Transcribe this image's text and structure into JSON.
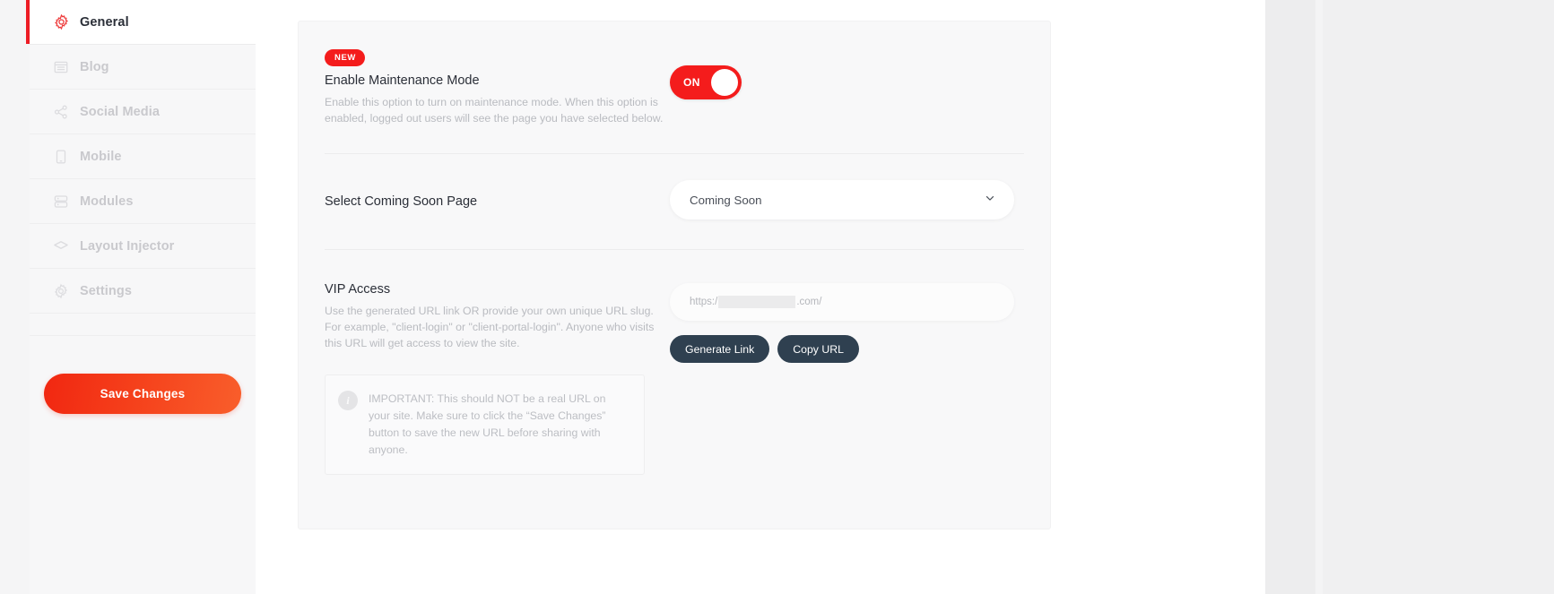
{
  "sidebar": {
    "items": [
      {
        "label": "General",
        "icon": "gear-icon",
        "active": true
      },
      {
        "label": "Blog",
        "icon": "blog-icon",
        "active": false
      },
      {
        "label": "Social Media",
        "icon": "share-icon",
        "active": false
      },
      {
        "label": "Mobile",
        "icon": "mobile-icon",
        "active": false
      },
      {
        "label": "Modules",
        "icon": "modules-icon",
        "active": false
      },
      {
        "label": "Layout Injector",
        "icon": "layers-icon",
        "active": false
      },
      {
        "label": "Settings",
        "icon": "settings-gear-icon",
        "active": false
      }
    ],
    "save_label": "Save Changes"
  },
  "maintenance": {
    "badge": "NEW",
    "title": "Enable Maintenance Mode",
    "description": "Enable this option to turn on maintenance mode. When this option is enabled, logged out users will see the page you have selected below.",
    "toggle_state": "ON"
  },
  "coming_soon": {
    "label": "Select Coming Soon Page",
    "selected": "Coming Soon",
    "chevron": "chevron-down-icon"
  },
  "vip": {
    "title": "VIP Access",
    "description": "Use the generated URL link OR provide your own unique URL slug. For example, \"client-login\" or \"client-portal-login\". Anyone who visits this URL will get access to view the site.",
    "url_prefix": "https:/",
    "url_suffix": ".com/",
    "generate_label": "Generate Link",
    "copy_label": "Copy URL",
    "notice_icon": "info-icon",
    "notice": "IMPORTANT: This should NOT be a real URL on your site. Make sure to click the “Save Changes” button to save the new URL before sharing with anyone."
  },
  "colors": {
    "accent_red": "#ed1c24",
    "badge_red": "#f41c1c",
    "toggle_on": "#f41c1c",
    "dark_button": "#2f4050",
    "muted_text": "#b9bbc0",
    "card_bg": "#f8f8f9"
  }
}
